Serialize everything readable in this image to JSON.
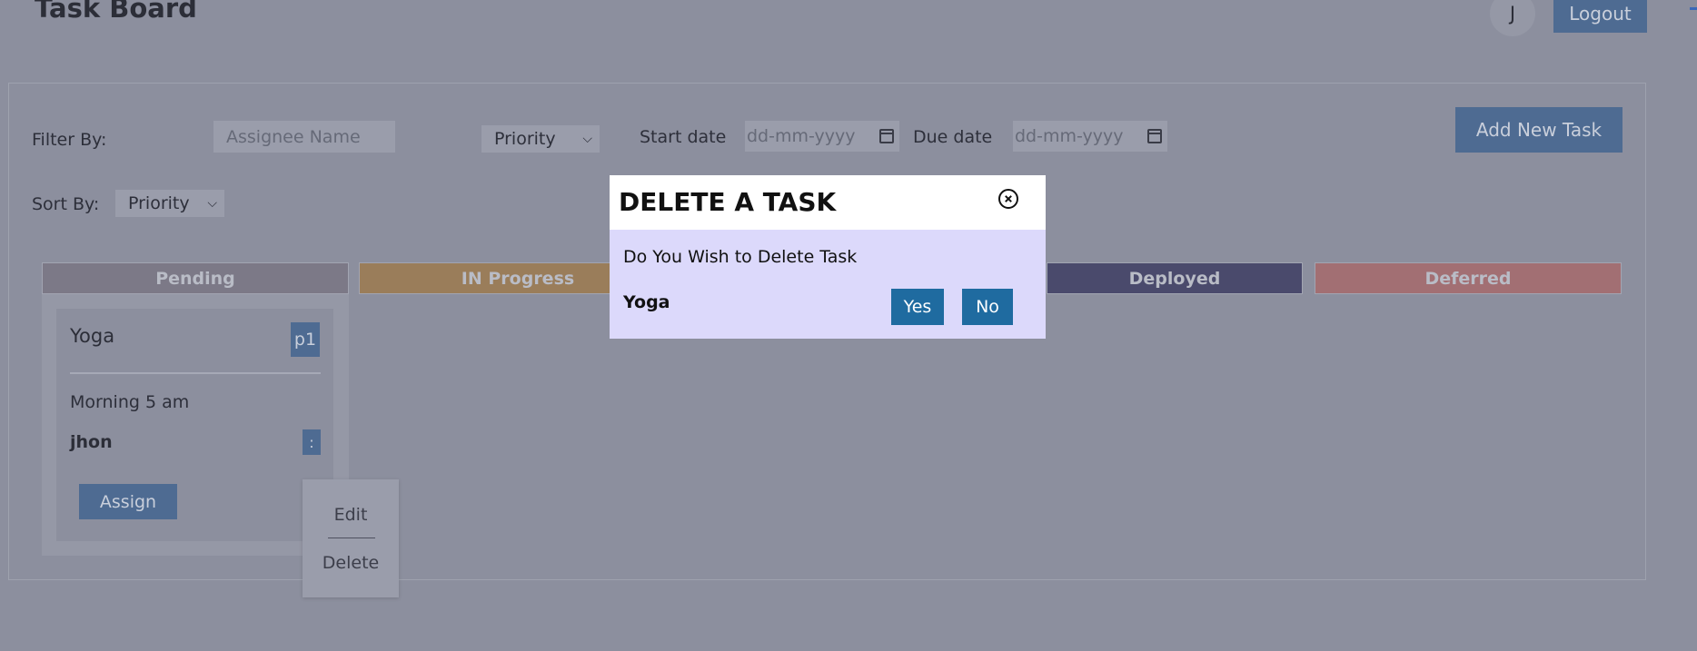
{
  "header": {
    "title": "Task Board",
    "avatar_initial": "J",
    "logout_label": "Logout"
  },
  "filters": {
    "filter_label": "Filter By:",
    "assignee_placeholder": "Assignee Name",
    "priority_label": "Priority",
    "start_label": "Start date",
    "start_placeholder": "dd-mm-yyyy",
    "due_label": "Due date",
    "due_placeholder": "dd-mm-yyyy",
    "sort_label": "Sort By:",
    "sort_value": "Priority",
    "add_task_label": "Add New Task"
  },
  "columns": [
    {
      "label": "Pending",
      "color": "#7c7987"
    },
    {
      "label": "IN Progress",
      "color": "#9a7d5a"
    },
    {
      "label": "Deployed",
      "color": "#4a4a6c"
    },
    {
      "label": "Deferred",
      "color": "#a26f73"
    }
  ],
  "task": {
    "title": "Yoga",
    "priority": "p1",
    "description": "Morning 5 am",
    "assignee": "jhon",
    "more_label": ":",
    "assign_label": "Assign"
  },
  "menu": {
    "edit": "Edit",
    "delete": "Delete"
  },
  "modal": {
    "title": "DELETE A TASK",
    "message": "Do You Wish to Delete Task",
    "task_name": "Yoga",
    "yes": "Yes",
    "no": "No"
  },
  "colors": {
    "accent": "#4e6b92",
    "modal_button": "#1f6ba0",
    "modal_body": "#dcd9fb"
  }
}
